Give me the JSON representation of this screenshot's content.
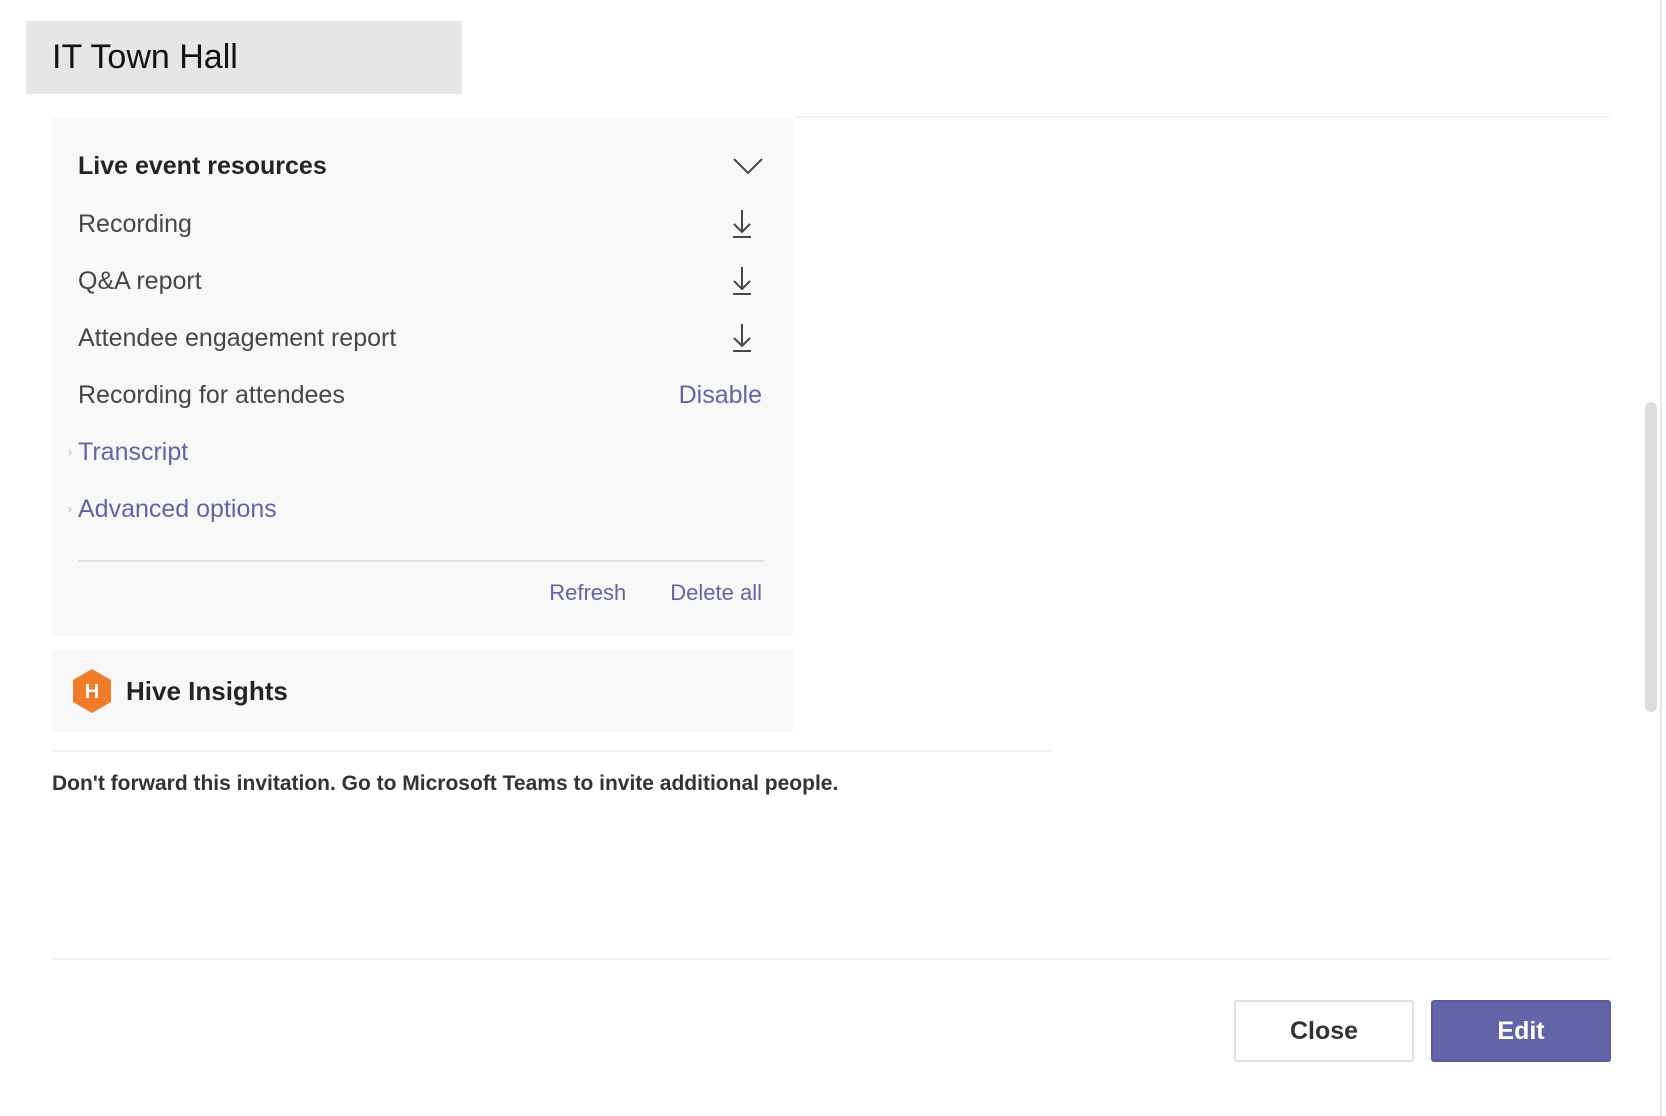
{
  "window": {
    "title": "IT Town Hall"
  },
  "resources": {
    "header": "Live event resources",
    "items": [
      {
        "label": "Recording",
        "action_icon": "download-icon"
      },
      {
        "label": "Q&A report",
        "action_icon": "download-icon"
      },
      {
        "label": "Attendee engagement report",
        "action_icon": "download-icon"
      }
    ],
    "recording_for_attendees": {
      "label": "Recording for attendees",
      "action": "Disable"
    },
    "transcript": "Transcript",
    "advanced_options": "Advanced options",
    "footer": {
      "refresh": "Refresh",
      "delete_all": "Delete all"
    }
  },
  "hive": {
    "name": "Hive Insights",
    "logo_letter": "H",
    "logo_color": "#f07c2a"
  },
  "notice": "Don't forward this invitation. Go to Microsoft Teams to invite additional people.",
  "buttons": {
    "close": "Close",
    "edit": "Edit"
  },
  "colors": {
    "accent": "#6264a7",
    "card_bg": "#f8f8f8"
  }
}
